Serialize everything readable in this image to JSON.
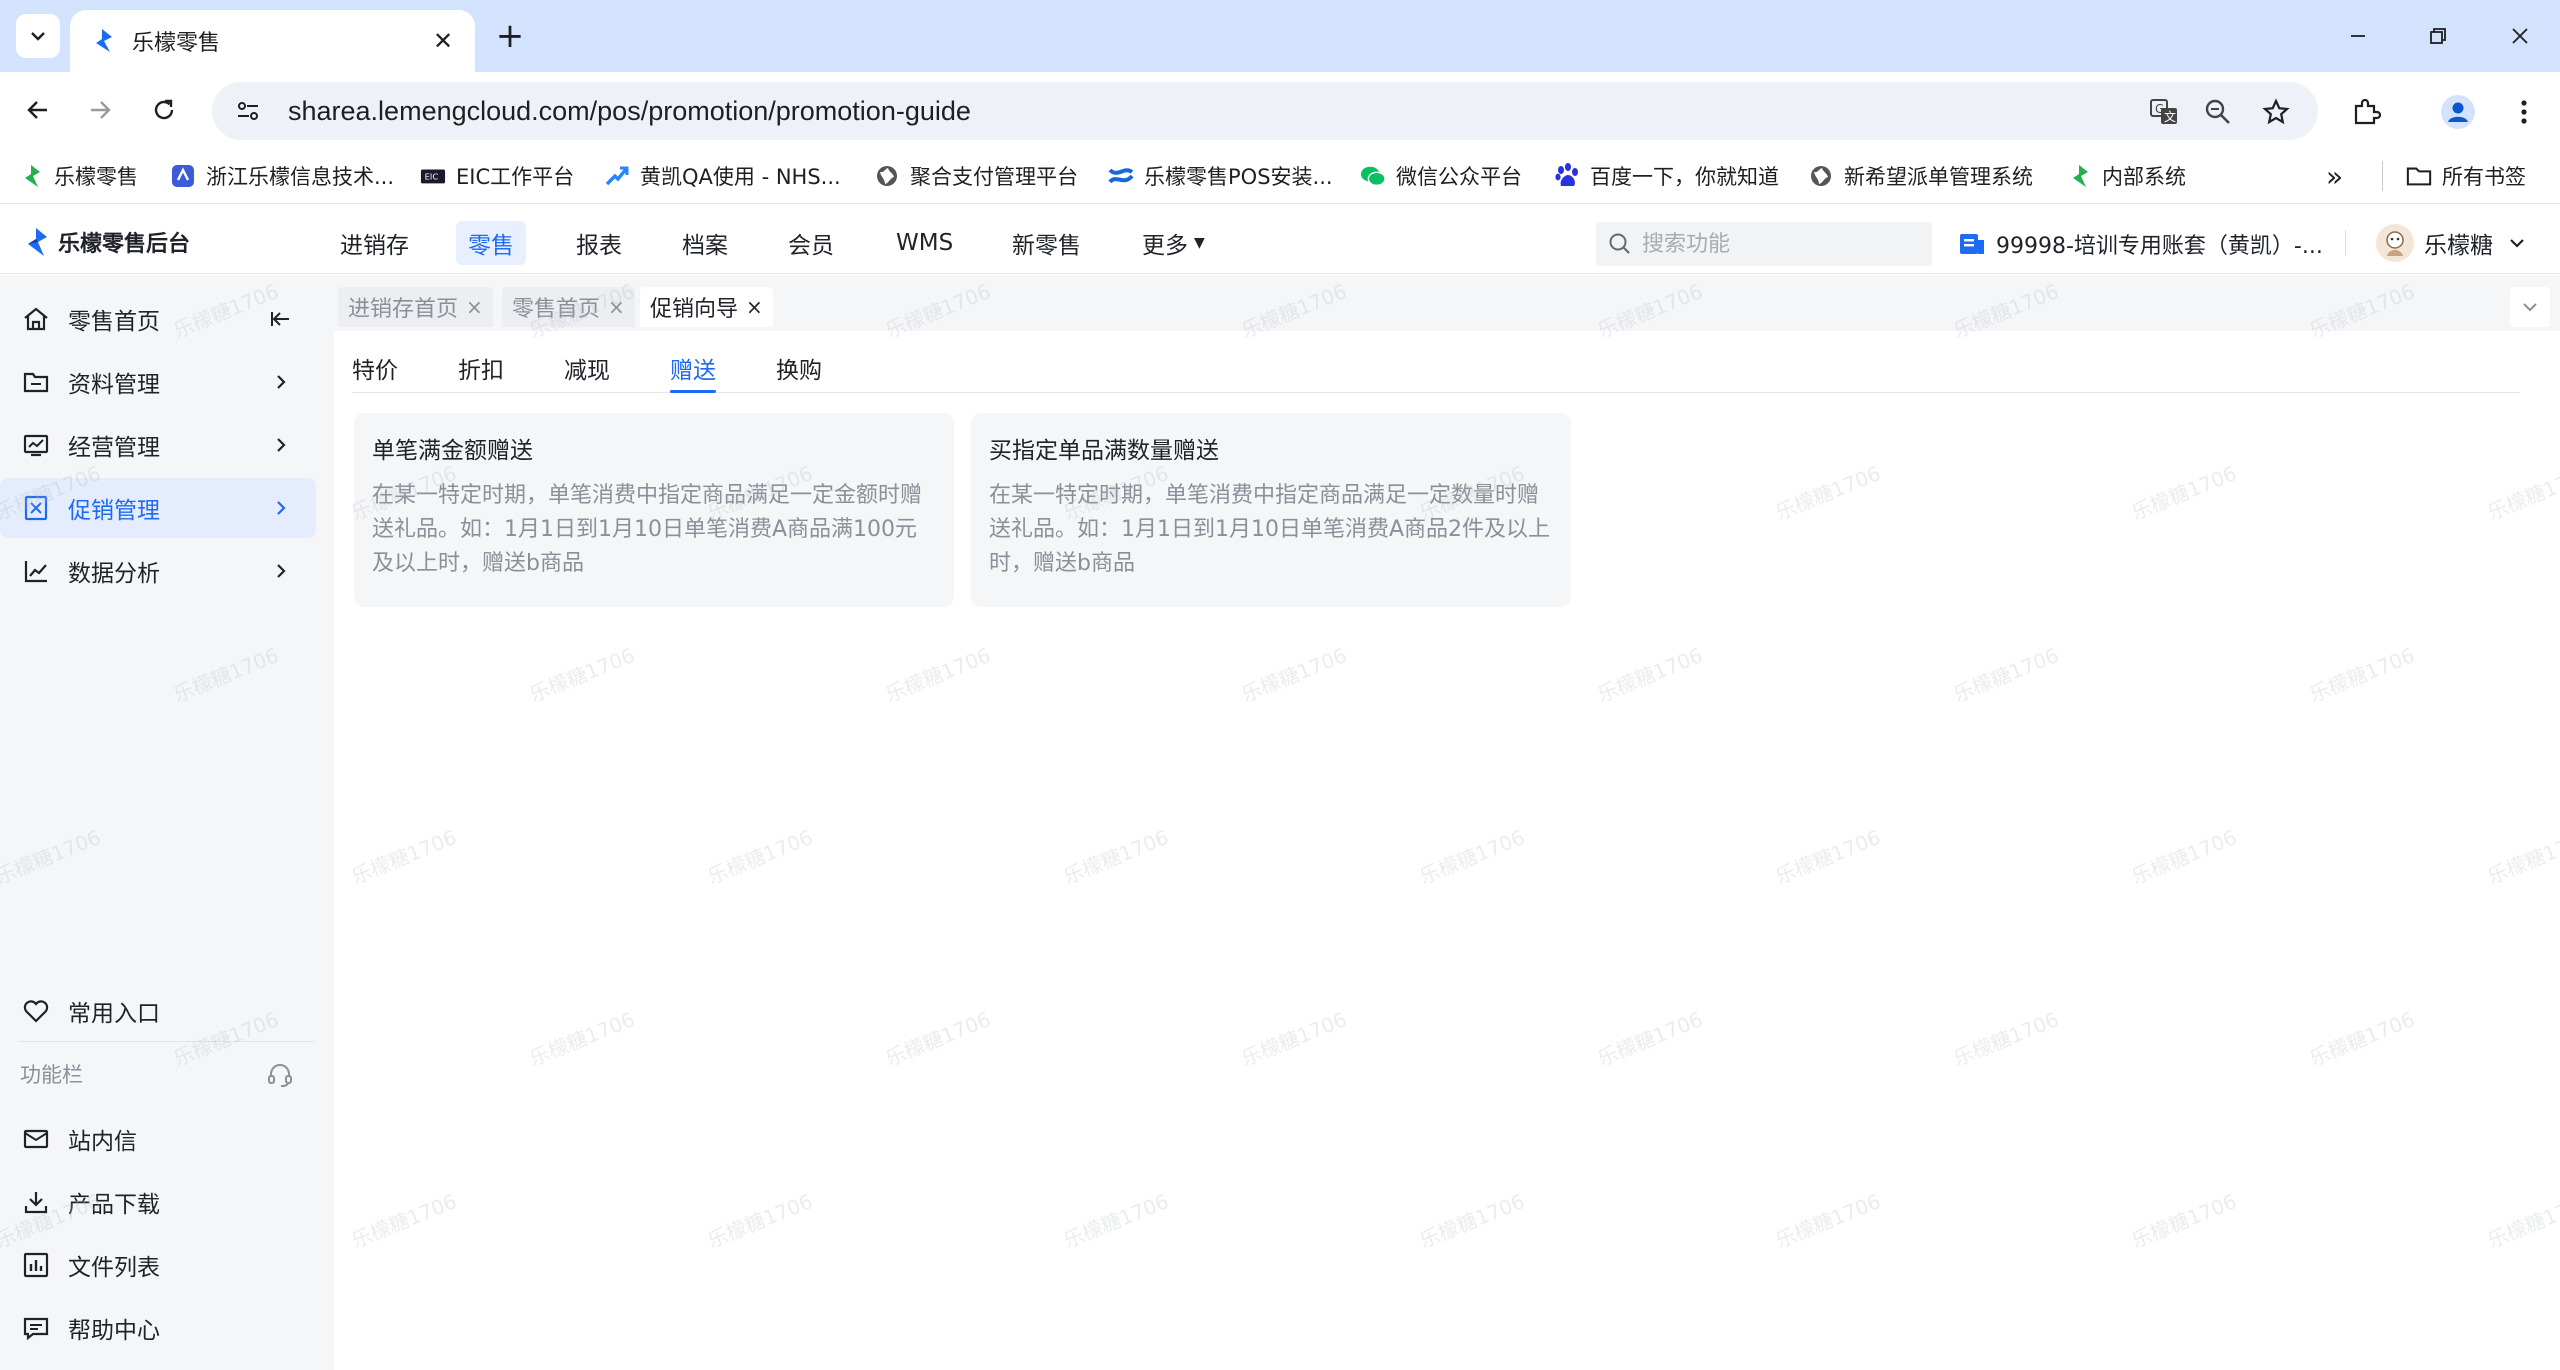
{
  "browser": {
    "tab_title": "乐檬零售",
    "url": "sharea.lemengcloud.com/pos/promotion/promotion-guide",
    "new_tab_symbol": "+",
    "close_symbol": "✕"
  },
  "bookmarks": [
    {
      "label": "乐檬零售",
      "icon": "lemeng-logo-icon",
      "color": "#22b14c"
    },
    {
      "label": "浙江乐檬信息技术...",
      "icon": "lemeng-blue-icon",
      "color": "#3b5bdb"
    },
    {
      "label": "EIC工作平台",
      "icon": "eic-icon",
      "color": "#1a1a2e"
    },
    {
      "label": "黄凯QA使用 - NHS...",
      "icon": "jira-icon",
      "color": "#2684ff"
    },
    {
      "label": "聚合支付管理平台",
      "icon": "globe-icon",
      "color": "#555555"
    },
    {
      "label": "乐檬零售POS安装...",
      "icon": "confluence-icon",
      "color": "#1868db"
    },
    {
      "label": "微信公众平台",
      "icon": "wechat-icon",
      "color": "#07c160"
    },
    {
      "label": "百度一下，你就知道",
      "icon": "baidu-icon",
      "color": "#2932e1"
    },
    {
      "label": "新希望派单管理系统",
      "icon": "globe-icon",
      "color": "#555555"
    },
    {
      "label": "内部系统",
      "icon": "lemeng-logo-icon",
      "color": "#22b14c"
    }
  ],
  "bookmarks_overflow": "»",
  "all_bookmarks": "所有书签",
  "app": {
    "brand": "乐檬零售后台",
    "nav": [
      "进销存",
      "零售",
      "报表",
      "档案",
      "会员",
      "WMS",
      "新零售",
      "更多"
    ],
    "active_nav": "零售",
    "search_placeholder": "搜索功能",
    "account": "99998-培训专用账套（黄凯）-...",
    "user": "乐檬糖"
  },
  "sidebar": {
    "items": [
      {
        "label": "零售首页",
        "icon": "home-icon"
      },
      {
        "label": "资料管理",
        "icon": "folder-icon"
      },
      {
        "label": "经营管理",
        "icon": "monitor-chart-icon"
      },
      {
        "label": "促销管理",
        "icon": "promotion-icon"
      },
      {
        "label": "数据分析",
        "icon": "line-chart-icon"
      }
    ],
    "favorites": "常用入口",
    "section_title": "功能栏",
    "tools": [
      {
        "label": "站内信",
        "icon": "mail-icon"
      },
      {
        "label": "产品下载",
        "icon": "download-icon"
      },
      {
        "label": "文件列表",
        "icon": "bar-chart-icon"
      },
      {
        "label": "帮助中心",
        "icon": "help-chat-icon"
      }
    ]
  },
  "page_tabs": [
    {
      "label": "进销存首页",
      "close": "×"
    },
    {
      "label": "零售首页",
      "close": "×"
    },
    {
      "label": "促销向导",
      "close": "×"
    }
  ],
  "sub_tabs": [
    "特价",
    "折扣",
    "减现",
    "赠送",
    "换购"
  ],
  "active_sub_tab": "赠送",
  "cards": [
    {
      "title": "单笔满金额赠送",
      "description": "在某一特定时期，单笔消费中指定商品满足一定金额时赠送礼品。如：1月1日到1月10日单笔消费A商品满100元及以上时，赠送b商品"
    },
    {
      "title": "买指定单品满数量赠送",
      "description": "在某一特定时期，单笔消费中指定商品满足一定数量时赠送礼品。如：1月1日到1月10日单笔消费A商品2件及以上时，赠送b商品"
    }
  ],
  "watermark": "乐檬糖1706",
  "colors": {
    "accent": "#1d6bf5",
    "chrome_tab_strip": "#d3e3fd",
    "sidebar_bg": "#f5f6f8",
    "card_bg": "#f5f6f8"
  }
}
